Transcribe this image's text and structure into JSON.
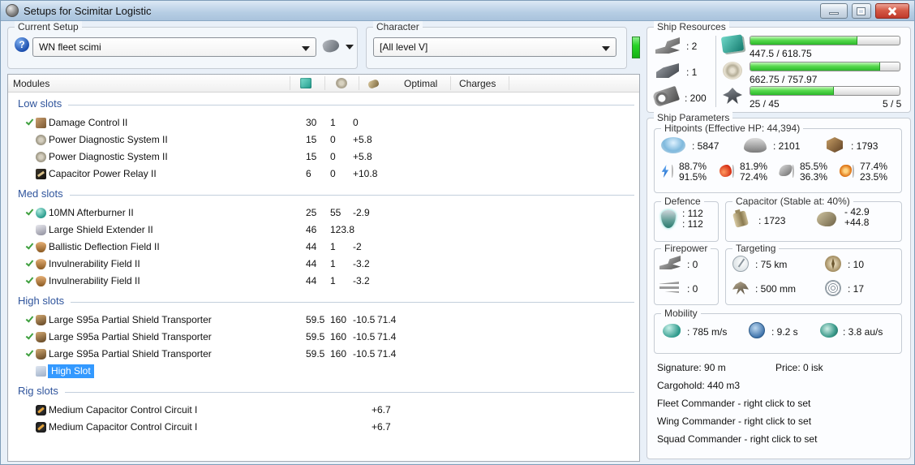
{
  "titlebar": {
    "title": "Setups for Scimitar Logistic"
  },
  "setup": {
    "label": "Current Setup",
    "value": "WN fleet scimi"
  },
  "character": {
    "label": "Character",
    "value": "[All level V]"
  },
  "colors": {
    "selection_blue": "#3399ff",
    "bar_green": "#3fd23c",
    "section_header_blue": "#2f549c",
    "indicator_green": "#27d427",
    "close_button_red": "#c0392b"
  },
  "icons": {
    "cpu-icon": "teal chip",
    "powergrid-icon": "gray starburst",
    "capacitor-icon": "bronze cell",
    "shield-hp-icon": "blue shield glow",
    "armor-hp-icon": "gray plate",
    "hull-hp-icon": "bronze cube",
    "em-resist-icon": "blue lightning",
    "thermal-resist-icon": "red flame",
    "kinetic-resist-icon": "gray streak",
    "explosive-resist-icon": "orange burst"
  },
  "table": {
    "col_modules": "Modules",
    "col_optimal": "Optimal",
    "col_charges": "Charges",
    "sections": [
      {
        "title": "Low slots",
        "rows": [
          {
            "name": "Damage Control II",
            "cpu": "30",
            "pg": "1",
            "cap": "0",
            "checked": true
          },
          {
            "name": "Power Diagnostic System II",
            "cpu": "15",
            "pg": "0",
            "cap": "+5.8",
            "checked": false
          },
          {
            "name": "Power Diagnostic System II",
            "cpu": "15",
            "pg": "0",
            "cap": "+5.8",
            "checked": false
          },
          {
            "name": "Capacitor Power Relay II",
            "cpu": "6",
            "pg": "0",
            "cap": "+10.8",
            "checked": false
          }
        ]
      },
      {
        "title": "Med slots",
        "rows": [
          {
            "name": "10MN Afterburner II",
            "cpu": "25",
            "pg": "55",
            "cap": "-2.9",
            "checked": true
          },
          {
            "name": "Large Shield Extender II",
            "cpu": "46",
            "pg": "123.8",
            "cap": "",
            "checked": false
          },
          {
            "name": "Ballistic Deflection Field II",
            "cpu": "44",
            "pg": "1",
            "cap": "-2",
            "checked": true
          },
          {
            "name": "Invulnerability Field II",
            "cpu": "44",
            "pg": "1",
            "cap": "-3.2",
            "checked": true
          },
          {
            "name": "Invulnerability Field II",
            "cpu": "44",
            "pg": "1",
            "cap": "-3.2",
            "checked": true
          }
        ]
      },
      {
        "title": "High slots",
        "rows": [
          {
            "name": "Large S95a Partial Shield Transporter",
            "cpu": "59.5",
            "pg": "160",
            "cap": "-10.5",
            "optimal": "71.4",
            "checked": true
          },
          {
            "name": "Large S95a Partial Shield Transporter",
            "cpu": "59.5",
            "pg": "160",
            "cap": "-10.5",
            "optimal": "71.4",
            "checked": true
          },
          {
            "name": "Large S95a Partial Shield Transporter",
            "cpu": "59.5",
            "pg": "160",
            "cap": "-10.5",
            "optimal": "71.4",
            "checked": true
          },
          {
            "name": "High Slot",
            "selected": true,
            "checked": false
          }
        ]
      },
      {
        "title": "Rig slots",
        "rows": [
          {
            "name": "Medium Capacitor Control Circuit I",
            "cap": "+6.7",
            "checked": false
          },
          {
            "name": "Medium Capacitor Control Circuit I",
            "cap": "+6.7",
            "checked": false
          }
        ]
      }
    ]
  },
  "resources": {
    "legend": "Ship Resources",
    "turrets": ": 2",
    "launchers": ": 1",
    "calibration": ": 200",
    "cpu": {
      "label": "447.5 / 618.75",
      "pct": 72
    },
    "powergrid": {
      "label": "662.75 / 757.97",
      "pct": 87
    },
    "drones": {
      "label": "25 / 45",
      "right": "5 / 5",
      "pct": 56
    }
  },
  "parameters": {
    "legend": "Ship Parameters",
    "hitpoints": {
      "legend": "Hitpoints (Effective HP: 44,394)",
      "shield": ": 5847",
      "armor": ": 2101",
      "hull": ": 1793",
      "resists": {
        "em_shield": "88.7%",
        "em_armor": "91.5%",
        "thermal_shield": "81.9%",
        "thermal_armor": "72.4%",
        "kinetic_shield": "85.5%",
        "kinetic_armor": "36.3%",
        "explosive_shield": "77.4%",
        "explosive_armor": "23.5%"
      }
    },
    "defence": {
      "legend": "Defence",
      "line1": ": 112",
      "line2": ": 112"
    },
    "capacitor": {
      "legend": "Capacitor (Stable at: 40%)",
      "amount": ": 1723",
      "drain": "- 42.9",
      "recharge": "+44.8"
    },
    "firepower": {
      "legend": "Firepower",
      "turret": ": 0",
      "missile": ": 0"
    },
    "targeting": {
      "legend": "Targeting",
      "range": ": 75 km",
      "scan_res": ": 500 mm",
      "max_targets": ": 10",
      "sensor_strength": ": 17"
    },
    "mobility": {
      "legend": "Mobility",
      "speed": ": 785 m/s",
      "align": ": 9.2 s",
      "warp": ": 3.8 au/s"
    },
    "signature": "Signature: 90 m",
    "price": "Price: 0 isk",
    "cargohold": "Cargohold: 440 m3",
    "fleet_cmd": "Fleet Commander - right click to set",
    "wing_cmd": "Wing Commander - right click to set",
    "squad_cmd": "Squad Commander - right click to set"
  }
}
